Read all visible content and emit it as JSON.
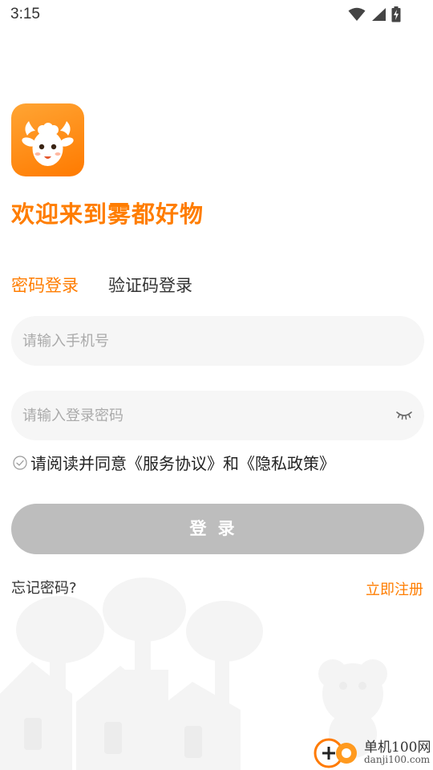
{
  "status_bar": {
    "time": "3:15"
  },
  "welcome_title": "欢迎来到雾都好物",
  "tabs": [
    {
      "label": "密码登录",
      "active": true
    },
    {
      "label": "验证码登录",
      "active": false
    }
  ],
  "phone": {
    "placeholder": "请输入手机号",
    "value": ""
  },
  "password": {
    "placeholder": "请输入登录密码",
    "value": ""
  },
  "agreement": {
    "prefix": "请阅读并同意",
    "service": "《服务协议》",
    "and": "和",
    "privacy": "《隐私政策》",
    "checked": false
  },
  "login_button": "登录",
  "forgot_password": "忘记密码?",
  "register": "立即注册",
  "watermark": {
    "brand_cn": "单机100网",
    "brand_url": "danji100.com"
  },
  "colors": {
    "accent": "#ff7d00",
    "button_disabled": "#bdbdbd",
    "field_bg": "#f6f6f6"
  },
  "icons": {
    "logo": "sheep-face-logo",
    "eye": "eye-closed-icon",
    "check": "check-circle-icon"
  }
}
